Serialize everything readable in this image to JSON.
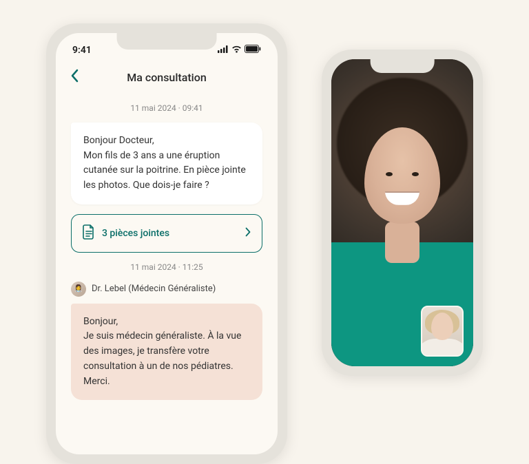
{
  "status": {
    "time": "9:41"
  },
  "header": {
    "title": "Ma consultation"
  },
  "chat": {
    "ts1": "11 mai 2024 · 09:41",
    "user_msg": "Bonjour Docteur,\nMon fils de 3 ans a une éruption cutanée sur la poitrine. En pièce jointe les photos. Que dois-je faire ?",
    "attachments_label": "3 pièces jointes",
    "ts2": "11 mai 2024 · 11:25",
    "sender": "Dr. Lebel (Médecin Généraliste)",
    "doctor_msg": "Bonjour,\nJe suis médecin généraliste. À la vue des images, je transfère votre consultation à un de nos pédiatres. Merci."
  },
  "colors": {
    "accent": "#0a6e68",
    "doctor_bubble": "#f5e1d6"
  }
}
